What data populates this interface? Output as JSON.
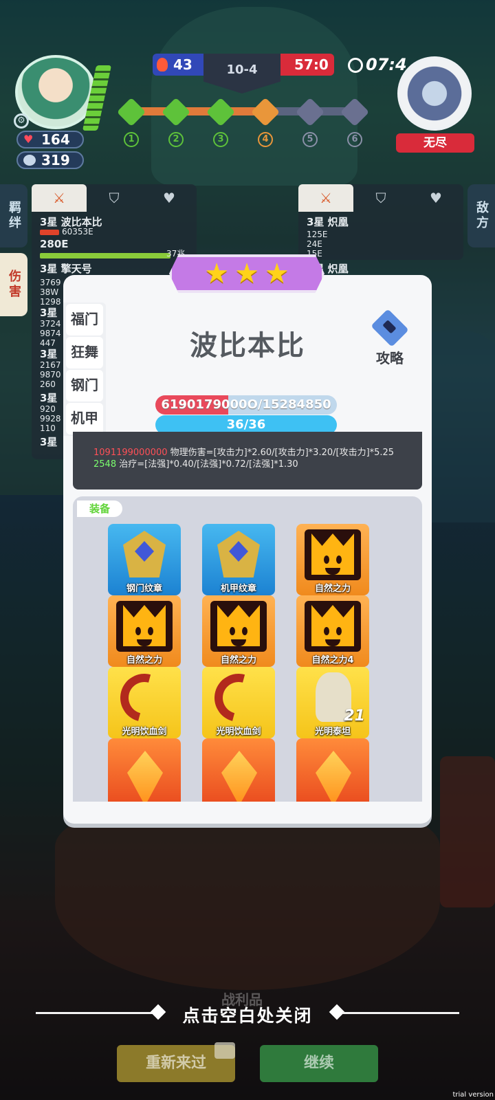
{
  "hud": {
    "hp": "164",
    "coins": "319",
    "blue_score": "43",
    "round": "10-4",
    "red_score": "57:0",
    "timer": "07:4",
    "enemy_label": "无尽",
    "stages": [
      "1",
      "2",
      "3",
      "4",
      "5",
      "6"
    ],
    "colors": {
      "blue": "#3148b8",
      "red": "#d92b3a"
    }
  },
  "left_tabs": [
    "羁绊",
    "伤害"
  ],
  "right_tabs": [
    "敌方"
  ],
  "left_panel": {
    "tabs": [
      "sword-icon",
      "shield-icon",
      "heart-icon"
    ],
    "rows": [
      {
        "name": "3星 波比本比",
        "sub": "60353E",
        "value": "280E",
        "bar_value": "37兆"
      },
      {
        "name": "3星 擎天号",
        "lines": [
          "3769",
          "38W",
          "1298"
        ]
      },
      {
        "name": "3星",
        "lines": [
          "3724",
          "9874",
          "447"
        ]
      },
      {
        "name": "3星",
        "lines": [
          "2167",
          "9870",
          "260"
        ]
      },
      {
        "name": "3星",
        "lines": [
          "920",
          "9928",
          "110"
        ]
      },
      {
        "name": "3星"
      }
    ]
  },
  "right_panel": {
    "tabs": [
      "sword-icon",
      "shield-icon",
      "heart-icon"
    ],
    "rows": [
      {
        "name": "3星 炽凰",
        "lines": [
          "125E",
          "24E",
          "15E"
        ]
      },
      {
        "name": "3星 炽凰"
      }
    ]
  },
  "modal": {
    "star_count": 3,
    "hero_name": "波比本比",
    "guide_label": "攻略",
    "traits": [
      "福门",
      "狂舞",
      "钢门",
      "机甲"
    ],
    "hp_text": "6190179000O/15284850",
    "hp_fraction": 0.4,
    "mp_text": "36/36",
    "damage_line1_value": "1091199000000",
    "damage_line1_rest": " 物理伤害=[攻击力]*2.60/[攻击力]*3.20/[攻击力]*5.25",
    "damage_line2_value": "2548",
    "damage_line2_rest": " 治疗=[法强]*0.40/[法强]*0.72/[法强]*1.30",
    "equip_label": "装备",
    "items": [
      {
        "label": "钢门纹章",
        "style": "blue",
        "icon": "emblem-icon"
      },
      {
        "label": "机甲纹章",
        "style": "blue",
        "icon": "emblem-icon"
      },
      {
        "label": "自然之力",
        "style": "orange",
        "icon": "crown-icon"
      },
      {
        "label": "自然之力",
        "style": "orange",
        "icon": "crown-icon"
      },
      {
        "label": "自然之力",
        "style": "orange",
        "icon": "crown-icon"
      },
      {
        "label": "自然之力4",
        "style": "orange",
        "icon": "crown-icon"
      },
      {
        "label": "光明饮血剑",
        "style": "yellow",
        "icon": "scythe-icon"
      },
      {
        "label": "光明饮血剑",
        "style": "yellow",
        "icon": "scythe-icon"
      },
      {
        "label": "光明泰坦",
        "style": "yellow",
        "icon": "titan-icon",
        "badge": "21"
      },
      {
        "label": "",
        "style": "red",
        "icon": "crystal-icon"
      },
      {
        "label": "",
        "style": "red",
        "icon": "crystal-icon"
      },
      {
        "label": "",
        "style": "red",
        "icon": "crystal-icon"
      }
    ]
  },
  "bottom": {
    "ghost_label": "战利品",
    "close_hint": "点击空白处关闭",
    "retry_label": "重新来过",
    "continue_label": "继续",
    "watermark": "trial version"
  }
}
